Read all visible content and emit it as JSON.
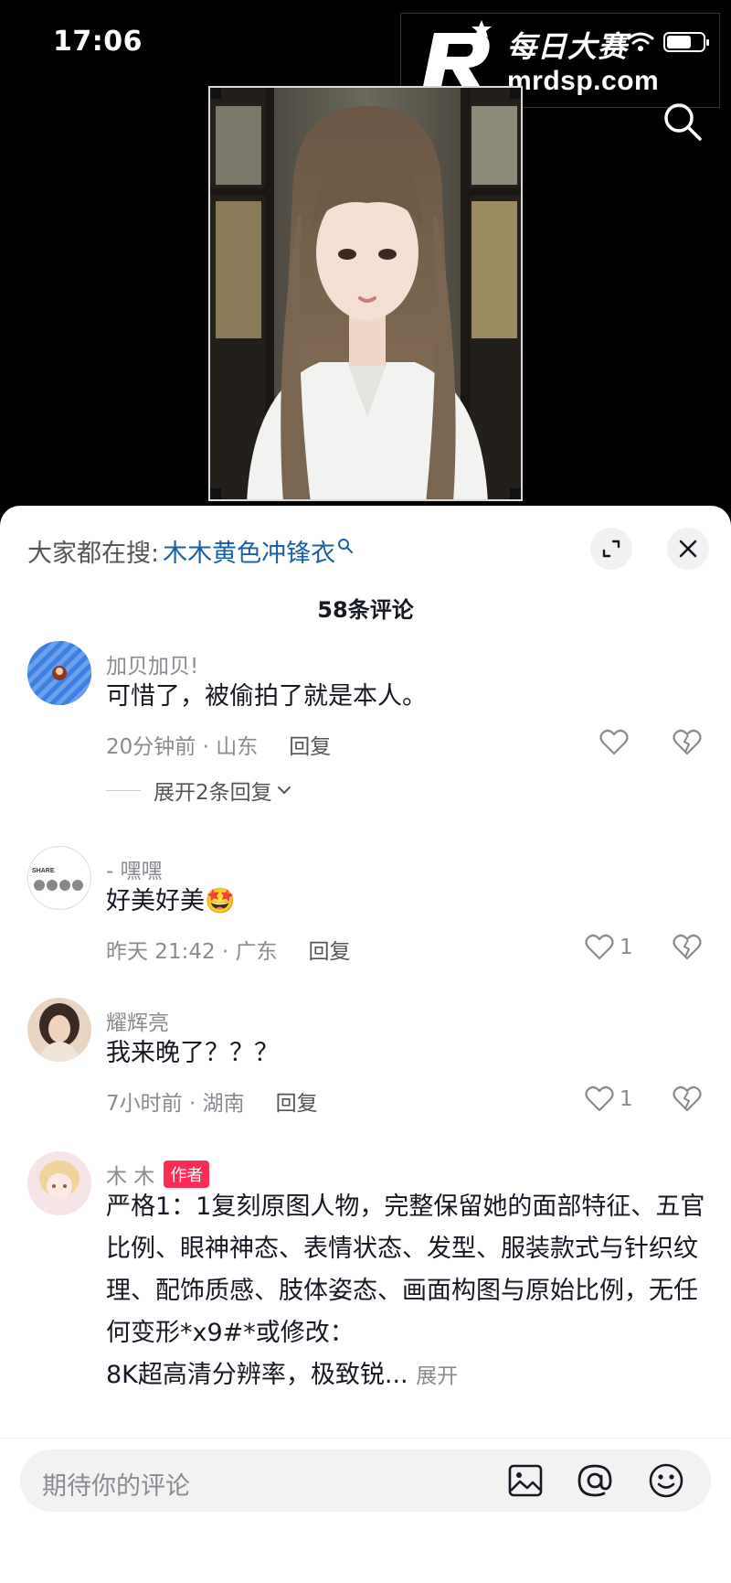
{
  "status_bar": {
    "time": "17:06",
    "battery_level": 0.7
  },
  "watermark": {
    "brand_cn": "每日大赛",
    "domain": "mrdsp.com"
  },
  "sheet": {
    "hot_search_label": "大家都在搜:",
    "hot_search_term": "木木黄色冲锋衣",
    "comment_count": "58条评论"
  },
  "comments": [
    {
      "user": "加贝加贝!",
      "text": "可惜了，被偷拍了就是本人。",
      "time_location": "20分钟前 · 山东",
      "reply": "回复",
      "likes": "",
      "expand_replies": "展开2条回复"
    },
    {
      "user": "- 嘿嘿",
      "text": "好美好美🤩",
      "time_location": "昨天 21:42 · 广东",
      "reply": "回复",
      "likes": "1",
      "avatar_text": "SHARE"
    },
    {
      "user": "耀辉亮",
      "text": "我来晚了？？？",
      "time_location": "7小时前 · 湖南",
      "reply": "回复",
      "likes": "1"
    },
    {
      "user": "木 木",
      "badge": "作者",
      "text": "严格1：1复刻原图人物，完整保留她的面部特征、五官比例、眼神神态、表情状态、发型、服装款式与针织纹理、配饰质感、肢体姿态、画面构图与原始比例，无任何变形*x9#*或修改：",
      "text_line2": "8K超高清分辨率，极致锐...",
      "more": "展开"
    }
  ],
  "input": {
    "placeholder": "期待你的评论"
  },
  "colors": {
    "accent": "#fe2c55",
    "link": "#1a5fa8",
    "secondary_text": "#8a8b91"
  }
}
